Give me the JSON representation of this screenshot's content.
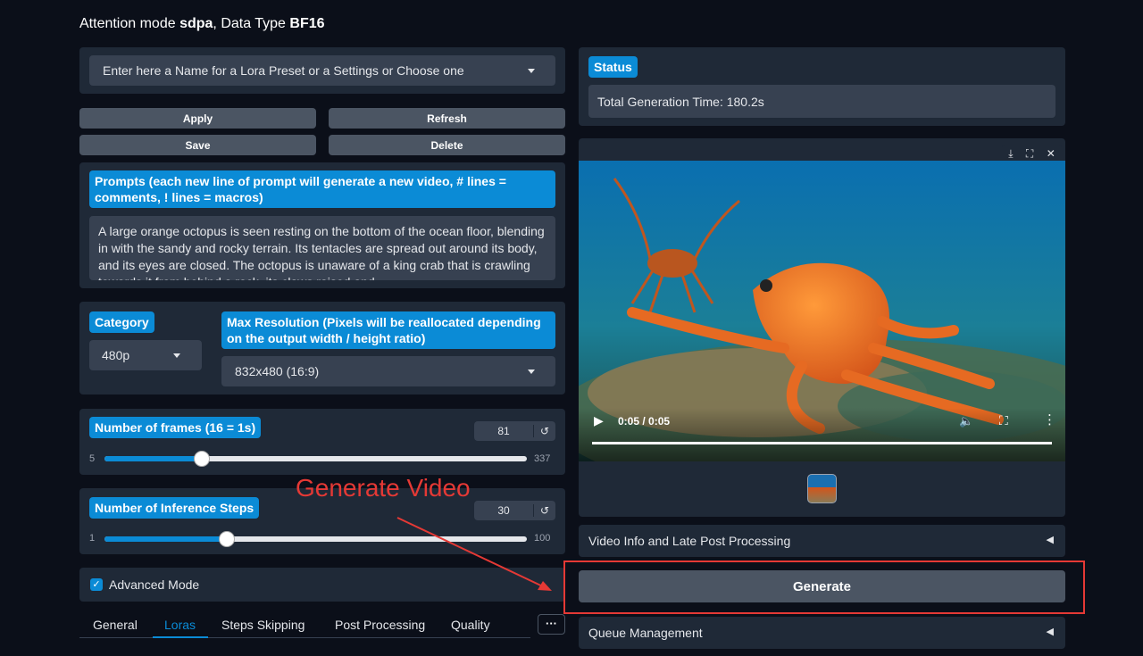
{
  "header": {
    "prefix": "Attention mode ",
    "mode": "sdpa",
    "middle": ", Data Type ",
    "dtype": "BF16"
  },
  "preset": {
    "placeholder": "Enter here a Name for a Lora Preset or a Settings or Choose one"
  },
  "buttons": {
    "apply": "Apply",
    "refresh": "Refresh",
    "save": "Save",
    "delete": "Delete",
    "generate": "Generate"
  },
  "prompts": {
    "label": "Prompts (each new line of prompt will generate a new video, # lines = comments, ! lines = macros)",
    "text": "A large orange octopus is seen resting on the bottom of the ocean floor, blending in with the sandy and rocky terrain. Its tentacles are spread out around its body, and its eyes are closed. The octopus is unaware of a king crab that is crawling towards it from behind a rock, its claws raised and"
  },
  "category": {
    "label": "Category",
    "value": "480p"
  },
  "max_resolution": {
    "label": "Max Resolution (Pixels will be reallocated depending on the output width / height ratio)",
    "value": "832x480 (16:9)"
  },
  "frames": {
    "label": "Number of frames (16 = 1s)",
    "value": "81",
    "min": "5",
    "max": "337",
    "fraction": 0.23
  },
  "steps": {
    "label": "Number of Inference Steps",
    "value": "30",
    "min": "1",
    "max": "100",
    "fraction": 0.29
  },
  "advanced": {
    "label": "Advanced Mode",
    "checked": true
  },
  "tabs": [
    "General",
    "Loras",
    "Steps Skipping",
    "Post Processing",
    "Quality"
  ],
  "tabs_more": "···",
  "active_tab": "Loras",
  "status": {
    "label": "Status",
    "text": "Total Generation Time: 180.2s"
  },
  "video": {
    "time": "0:05 / 0:05"
  },
  "accordions": {
    "video_info": "Video Info and Late Post Processing",
    "queue": "Queue Management"
  },
  "annotation": {
    "text": "Generate Video",
    "color": "#e53935"
  },
  "colors": {
    "accent": "#0b8bd6",
    "background": "#0b0f19",
    "panel": "#1f2937"
  },
  "icons": {
    "reset": "reset-icon",
    "download": "download-icon",
    "fullscreen": "fullscreen-icon",
    "close": "close-icon",
    "play": "play-icon",
    "volume": "volume-icon",
    "menu": "more-icon"
  }
}
